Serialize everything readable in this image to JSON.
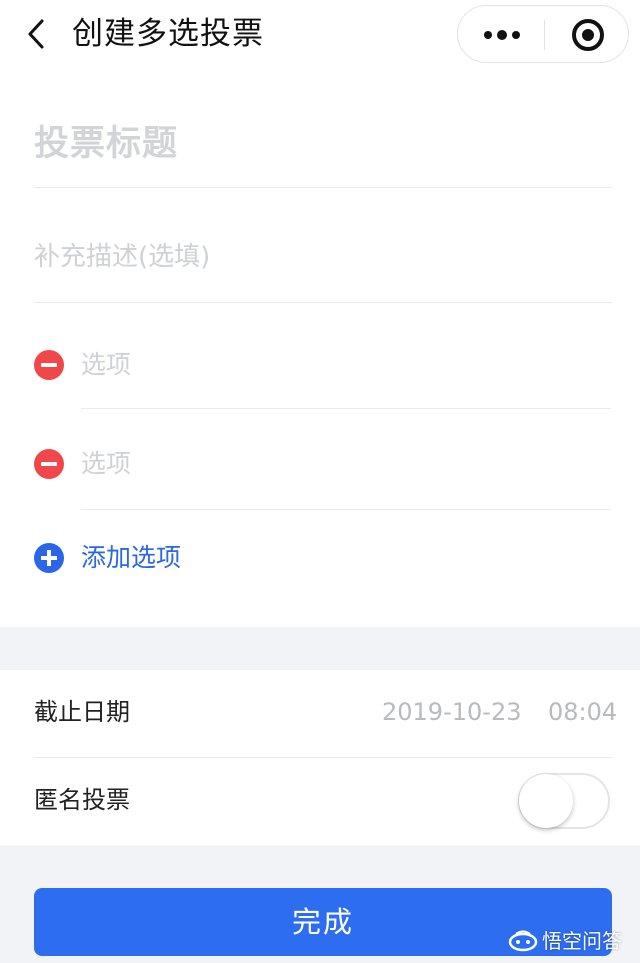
{
  "navbar": {
    "title": "创建多选投票"
  },
  "form": {
    "title_placeholder": "投票标题",
    "description_placeholder": "补充描述(选填)",
    "options": [
      {
        "placeholder": "选项"
      },
      {
        "placeholder": "选项"
      }
    ],
    "add_option_label": "添加选项"
  },
  "settings": {
    "deadline_label": "截止日期",
    "deadline_date": "2019-10-23",
    "deadline_time": "08:04",
    "anonymous_label": "匿名投票",
    "anonymous_enabled": false
  },
  "submit_label": "完成",
  "watermark": {
    "text": "悟空问答"
  },
  "colors": {
    "accent": "#2d6df0",
    "danger": "#f0474a",
    "placeholder": "#cfd1d5",
    "background": "#f2f3f6"
  }
}
